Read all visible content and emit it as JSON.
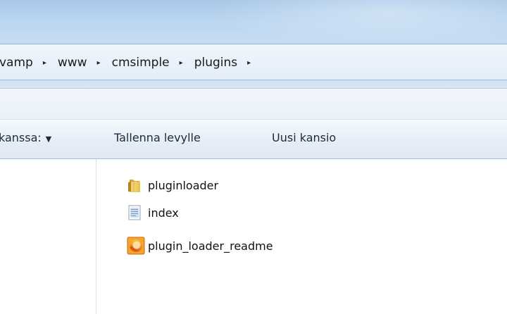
{
  "breadcrumb": {
    "items": [
      "vamp",
      "www",
      "cmsimple",
      "plugins"
    ],
    "separator": "▸"
  },
  "toolbar": {
    "share_label": "kanssa:",
    "burn_label": "Tallenna levylle",
    "new_folder_label": "Uusi kansio"
  },
  "files": [
    {
      "name": "pluginloader",
      "icon": "folder-icon"
    },
    {
      "name": "index",
      "icon": "text-file-icon"
    },
    {
      "name": "plugin_loader_readme",
      "icon": "html-file-icon"
    }
  ],
  "colors": {
    "title_bar": "#bdd7f0",
    "address_bar": "#eef5fc",
    "toolbar": "#e6eef7",
    "folder": "#e9c35a"
  }
}
